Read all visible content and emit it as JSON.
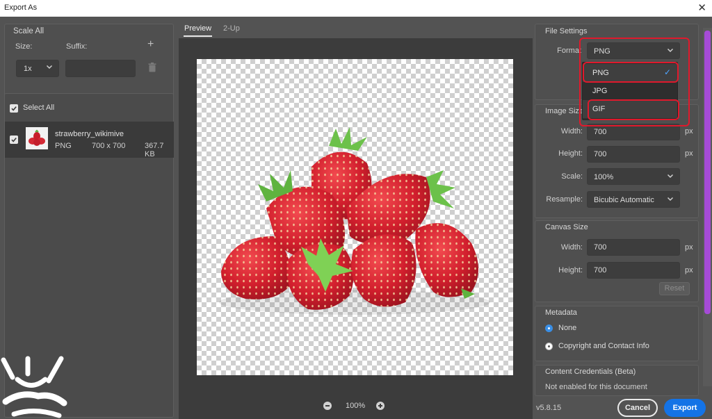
{
  "window": {
    "title": "Export As",
    "close_icon": "close-icon"
  },
  "left": {
    "scale_all": {
      "heading": "Scale All",
      "size_label": "Size:",
      "suffix_label": "Suffix:",
      "size_value": "1x",
      "suffix_value": ""
    },
    "select_all_label": "Select All",
    "select_all_checked": true,
    "files": [
      {
        "name": "strawberry_wikimive",
        "format": "PNG",
        "dimensions": "700 x 700",
        "size": "367.7 KB",
        "checked": true
      }
    ]
  },
  "center": {
    "tabs": [
      {
        "label": "Preview",
        "active": true
      },
      {
        "label": "2-Up",
        "active": false
      }
    ],
    "zoom": "100%"
  },
  "right": {
    "file_settings": {
      "heading": "File Settings",
      "format_label": "Format",
      "format_value": "PNG",
      "dropdown_options": [
        {
          "label": "PNG",
          "selected": true
        },
        {
          "label": "JPG",
          "selected": false
        },
        {
          "label": "GIF",
          "selected": false
        }
      ]
    },
    "image_size": {
      "heading": "Image Size",
      "width_label": "Width:",
      "width_value": "700",
      "height_label": "Height:",
      "height_value": "700",
      "scale_label": "Scale:",
      "scale_value": "100%",
      "resample_label": "Resample:",
      "resample_value": "Bicubic Automatic",
      "unit": "px"
    },
    "canvas_size": {
      "heading": "Canvas Size",
      "width_label": "Width:",
      "width_value": "700",
      "height_label": "Height:",
      "height_value": "700",
      "unit": "px",
      "reset_label": "Reset"
    },
    "metadata": {
      "heading": "Metadata",
      "options": [
        {
          "label": "None",
          "selected": true
        },
        {
          "label": "Copyright and Contact Info",
          "selected": false
        }
      ]
    },
    "credentials": {
      "heading": "Content Credentials (Beta)",
      "status": "Not enabled for this document"
    }
  },
  "footer": {
    "version": "v5.8.15",
    "cancel_label": "Cancel",
    "export_label": "Export"
  },
  "colors": {
    "accent": "#1473e6",
    "highlight": "#e0192c",
    "scroll_thumb": "#a54bd6",
    "radio_on": "#3a8fe6"
  }
}
